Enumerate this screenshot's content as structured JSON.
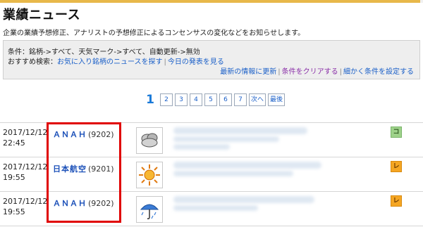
{
  "header": {
    "title": "業績ニュース",
    "accent_color": "#e8b84a"
  },
  "description": "企業の業績予想修正、アナリストの予想修正によるコンセンサスの変化などをお知らせします。",
  "filters": {
    "conditions": "条件：銘柄->すべて、天気マーク->すべて、自動更新->無効",
    "recommend_label": "おすすめ検索：",
    "recommend_links": [
      "お気に入り銘柄のニュースを探す",
      "今日の発表を見る"
    ],
    "actions": [
      "最新の情報に更新",
      "条件をクリアする",
      "細かく条件を設定する"
    ]
  },
  "pagination": {
    "current": "1",
    "pages": [
      "2",
      "3",
      "4",
      "5",
      "6",
      "7"
    ],
    "next_label": "次へ",
    "last_label": "最後"
  },
  "news": [
    {
      "date": "2017/12/12",
      "time": "22:45",
      "stock_name": "ＡＮＡＨ",
      "stock_code": "(9202)",
      "weather_icon": "cloudy-icon",
      "tag": "コ",
      "tag_color": "#9ed28a"
    },
    {
      "date": "2017/12/12",
      "time": "19:55",
      "stock_name": "日本航空",
      "stock_code": "(9201)",
      "weather_icon": "sunny-icon",
      "tag": "レ",
      "tag_color": "#f5a623"
    },
    {
      "date": "2017/12/12",
      "time": "19:55",
      "stock_name": "ＡＮＡＨ",
      "stock_code": "(9202)",
      "weather_icon": "rain-umbrella-icon",
      "tag": "レ",
      "tag_color": "#f5a623"
    }
  ],
  "highlight_color": "#e00000"
}
